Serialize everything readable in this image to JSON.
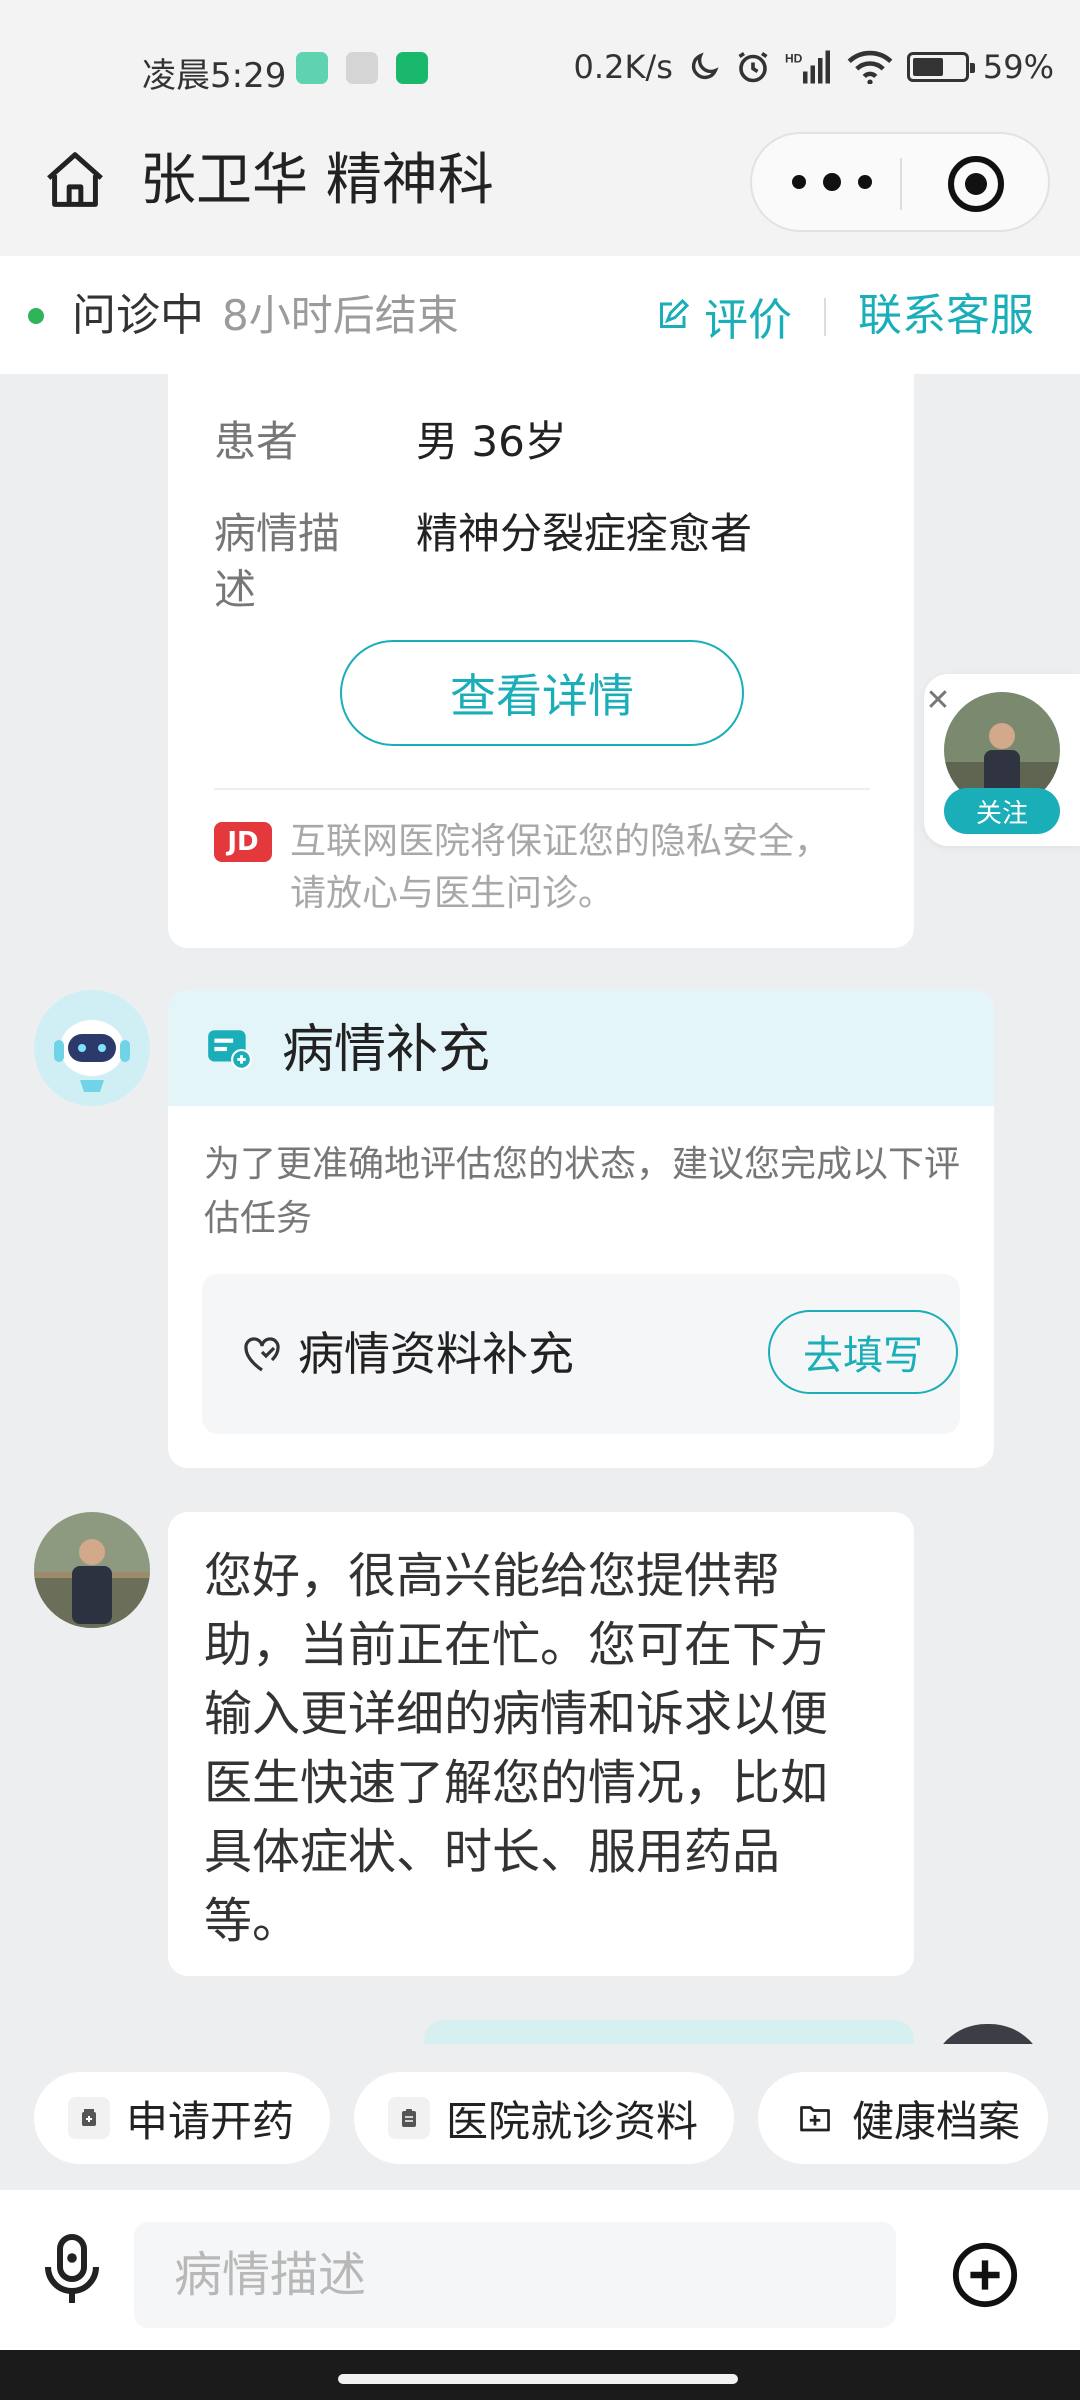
{
  "status_bar": {
    "time": "凌晨5:29",
    "network_speed": "0.2K/s",
    "battery_percent": "59%",
    "battery_level": 0.59,
    "icons": [
      "app-icon-1",
      "shield-app-icon",
      "phone-app-icon",
      "moon-icon",
      "alarm-icon",
      "hd-signal-icon",
      "wifi-icon",
      "battery-icon"
    ]
  },
  "nav": {
    "title": "张卫华 精神科",
    "home_icon": "home-icon",
    "more_icon": "more-icon",
    "target_icon": "target-icon"
  },
  "consult": {
    "state": "问诊中",
    "remaining": "8小时后结束",
    "rate_label": "评价",
    "contact_label": "联系客服",
    "accent_color": "#1aaeb8",
    "dot_color": "#2fb45a"
  },
  "patient_card": {
    "patient_label": "患者",
    "patient_value": "男 36岁",
    "description_label": "病情描述",
    "description_value": "精神分裂症痊愈者",
    "detail_button": "查看详情",
    "jd_badge": "JD",
    "privacy_note": "互联网医院将保证您的隐私安全，请放心与医生问诊。"
  },
  "follow_float": {
    "close_glyph": "✕",
    "button_label": "关注"
  },
  "supplement_card": {
    "title": "病情补充",
    "description": "为了更准确地评估您的状态，建议您完成以下评估任务",
    "task_label": "病情资料补充",
    "task_button": "去填写"
  },
  "doctor_message": {
    "text": "您好，很高兴能给您提供帮助，当前正在忙。您可在下方输入更详细的病情和诉求以便医生快速了解您的情况，比如具体症状、时长、服用药品等。"
  },
  "quick_actions": [
    {
      "label": "申请开药",
      "icon": "medicine-icon"
    },
    {
      "label": "医院就诊资料",
      "icon": "clipboard-icon"
    },
    {
      "label": "健康档案",
      "icon": "folder-plus-icon"
    }
  ],
  "input_bar": {
    "placeholder": "病情描述",
    "mic_icon": "microphone-icon",
    "plus_icon": "plus-circle-icon"
  }
}
